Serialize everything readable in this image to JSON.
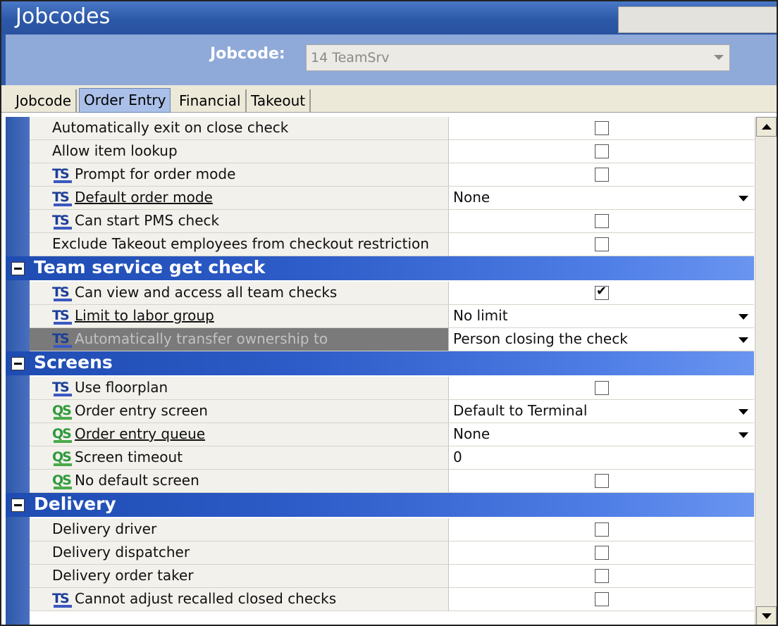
{
  "window": {
    "title": "Jobcodes"
  },
  "selector": {
    "label": "Jobcode:",
    "value": "14 TeamSrv"
  },
  "tabs": [
    {
      "label": "Jobcode",
      "active": false
    },
    {
      "label": "Order Entry",
      "active": true
    },
    {
      "label": "Financial",
      "active": false
    },
    {
      "label": "Takeout",
      "active": false
    }
  ],
  "rows_top": [
    {
      "label": "Automatically exit on close check",
      "badge": "",
      "type": "checkbox",
      "checked": false
    },
    {
      "label": "Allow item lookup",
      "badge": "",
      "type": "checkbox",
      "checked": false
    },
    {
      "label": "Prompt for order mode",
      "badge": "TS",
      "type": "checkbox",
      "checked": false
    },
    {
      "label": "Default order mode",
      "badge": "TS",
      "type": "dropdown",
      "value": "None",
      "link": true
    },
    {
      "label": "Can start PMS check",
      "badge": "TS",
      "type": "checkbox",
      "checked": false
    },
    {
      "label": "Exclude Takeout employees from checkout restriction",
      "badge": "",
      "type": "checkbox",
      "checked": false
    }
  ],
  "sections": {
    "team": {
      "title": "Team service get check",
      "rows": [
        {
          "label": "Can view and access all team checks",
          "badge": "TS",
          "type": "checkbox",
          "checked": true
        },
        {
          "label": "Limit to labor group",
          "badge": "TS",
          "type": "dropdown",
          "value": "No limit",
          "link": true
        },
        {
          "label": "Automatically transfer ownership to",
          "badge": "TS",
          "type": "dropdown",
          "value": "Person closing the check",
          "selected": true
        }
      ]
    },
    "screens": {
      "title": "Screens",
      "rows": [
        {
          "label": "Use floorplan",
          "badge": "TS",
          "type": "checkbox",
          "checked": false
        },
        {
          "label": "Order entry screen",
          "badge": "QS",
          "type": "dropdown",
          "value": "Default to Terminal"
        },
        {
          "label": "Order entry queue",
          "badge": "QS",
          "type": "dropdown",
          "value": "None",
          "link": true
        },
        {
          "label": "Screen timeout",
          "badge": "QS",
          "type": "text",
          "value": "0"
        },
        {
          "label": "No default screen",
          "badge": "QS",
          "type": "checkbox",
          "checked": false
        }
      ]
    },
    "delivery": {
      "title": "Delivery",
      "rows": [
        {
          "label": "Delivery driver",
          "badge": "",
          "type": "checkbox",
          "checked": false
        },
        {
          "label": "Delivery dispatcher",
          "badge": "",
          "type": "checkbox",
          "checked": false
        },
        {
          "label": "Delivery order taker",
          "badge": "",
          "type": "checkbox",
          "checked": false
        },
        {
          "label": "Cannot adjust recalled closed checks",
          "badge": "TS",
          "type": "checkbox",
          "checked": false
        }
      ]
    }
  },
  "badges": {
    "TS": "TS",
    "QS": "QS"
  },
  "checkmark_glyph": "✔",
  "icons": {
    "collapse": "minus-box-icon",
    "dropdown": "chevron-down-icon",
    "scroll_up": "scroll-up-icon",
    "scroll_down": "scroll-down-icon"
  },
  "colors": {
    "title_bar": "#2c58a8",
    "selector_band": "#8fa9d8",
    "section_header": "#2e5cc8",
    "selected_row": "#7a7a7a",
    "ts_badge": "#1d3f9a",
    "qs_badge": "#2e9a3c"
  }
}
